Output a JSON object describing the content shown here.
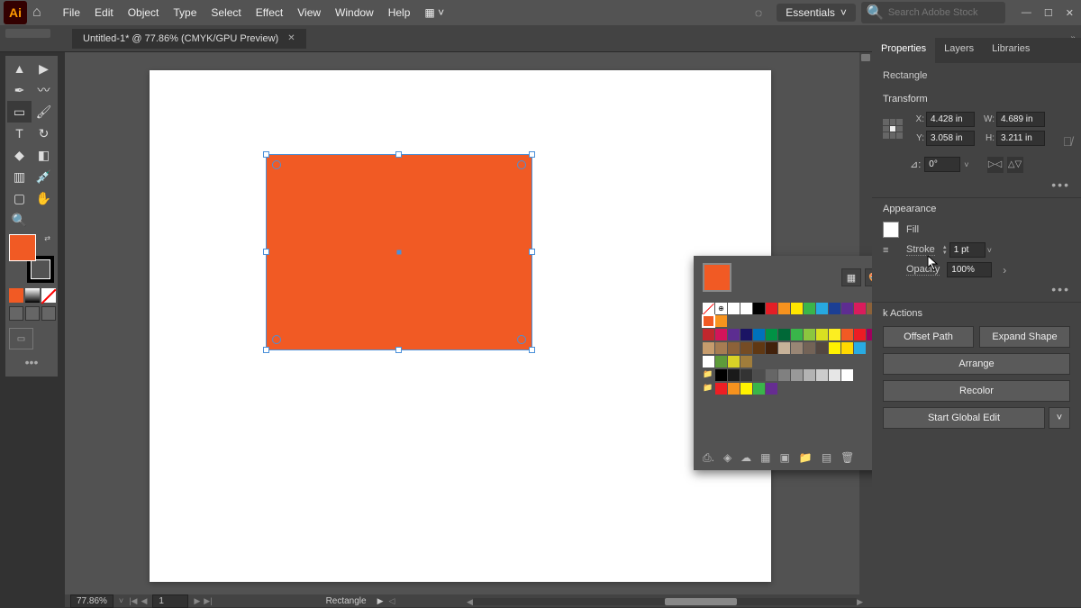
{
  "menu": {
    "items": [
      "File",
      "Edit",
      "Object",
      "Type",
      "Select",
      "Effect",
      "View",
      "Window",
      "Help"
    ],
    "workspace": "Essentials",
    "search_placeholder": "Search Adobe Stock"
  },
  "tab": {
    "title": "Untitled-1* @ 77.86% (CMYK/GPU Preview)"
  },
  "statusbar": {
    "zoom": "77.86%",
    "artboard_num": "1",
    "selection": "Rectangle"
  },
  "right_panel": {
    "tabs": [
      "Properties",
      "Layers",
      "Libraries"
    ],
    "object_type": "Rectangle",
    "sections": {
      "transform": {
        "title": "Transform",
        "x": "4.428 in",
        "y": "3.058 in",
        "w": "4.689 in",
        "h": "3.211 in",
        "rotate": "0°"
      },
      "appearance": {
        "title": "Appearance",
        "fill_label": "Fill",
        "stroke_label": "Stroke",
        "stroke_weight": "1 pt",
        "opacity_label": "Opacity",
        "opacity_value": "100%"
      },
      "quick_actions": {
        "title": "k Actions",
        "offset_path": "Offset Path",
        "expand_shape": "Expand Shape",
        "arrange": "Arrange",
        "recolor": "Recolor",
        "global_edit": "Start Global Edit"
      }
    }
  },
  "swatches": {
    "colors_row1": [
      "#ffffff",
      "#ffffff",
      "#000000",
      "#e41e26",
      "#f6921e",
      "#ffe600",
      "#3ab54a",
      "#27a9e1",
      "#1c3f94",
      "#5e2d91",
      "#da1c5c",
      "#8c6239",
      "#f15a24",
      "#f7941e"
    ],
    "colors_row2": [
      "#c1272d",
      "#d4145a",
      "#5c2d91",
      "#1b1464",
      "#0071bc",
      "#009245",
      "#006837",
      "#39b54a",
      "#8cc63f",
      "#d9e021",
      "#fcee21",
      "#f15a24",
      "#ed1c24",
      "#9e005d"
    ],
    "colors_row3": [
      "#c69c6d",
      "#a67c52",
      "#8c6239",
      "#754c24",
      "#603813",
      "#42210b",
      "#c7b299",
      "#998675",
      "#736357",
      "#534741",
      "#fff200",
      "#ffd800",
      "#29abe2"
    ],
    "colors_row4": [
      "#5e9b3a",
      "#d9d326",
      "#a07d3b"
    ],
    "grays": [
      "#000000",
      "#1a1a1a",
      "#333333",
      "#4d4d4d",
      "#666666",
      "#808080",
      "#999999",
      "#b3b3b3",
      "#cccccc",
      "#e6e6e6",
      "#ffffff"
    ],
    "brights": [
      "#ed1e24",
      "#f6921e",
      "#fff200",
      "#3ab54a",
      "#662d91"
    ],
    "current": "#f15a24",
    "selected_index": 12
  },
  "canvas": {
    "rect_fill": "#f15a24"
  }
}
